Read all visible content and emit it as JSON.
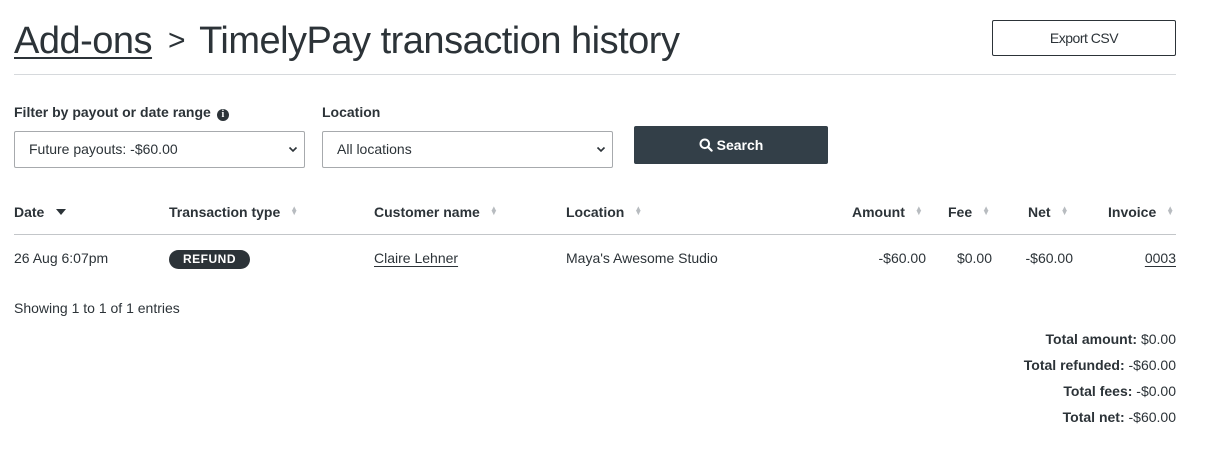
{
  "breadcrumb": {
    "parent": "Add-ons",
    "separator": ">",
    "current": "TimelyPay transaction history"
  },
  "export_button": "Export CSV",
  "filters": {
    "payout_label": "Filter by payout or date range",
    "payout_value": "Future payouts: -$60.00",
    "location_label": "Location",
    "location_value": "All locations",
    "search_button": "Search"
  },
  "table": {
    "headers": [
      "Date",
      "Transaction type",
      "Customer name",
      "Location",
      "Amount",
      "Fee",
      "Net",
      "Invoice"
    ],
    "rows": [
      {
        "date": "26 Aug 6:07pm",
        "type": "REFUND",
        "customer": "Claire Lehner",
        "location": "Maya's Awesome Studio",
        "amount": "-$60.00",
        "fee": "$0.00",
        "net": "-$60.00",
        "invoice": "0003"
      }
    ]
  },
  "info": "Showing 1 to 1 of 1 entries",
  "totals": {
    "amount_label": "Total amount:",
    "amount": "$0.00",
    "refunded_label": "Total refunded:",
    "refunded": "-$60.00",
    "fees_label": "Total fees:",
    "fees": "-$0.00",
    "net_label": "Total net:",
    "net": "-$60.00"
  }
}
